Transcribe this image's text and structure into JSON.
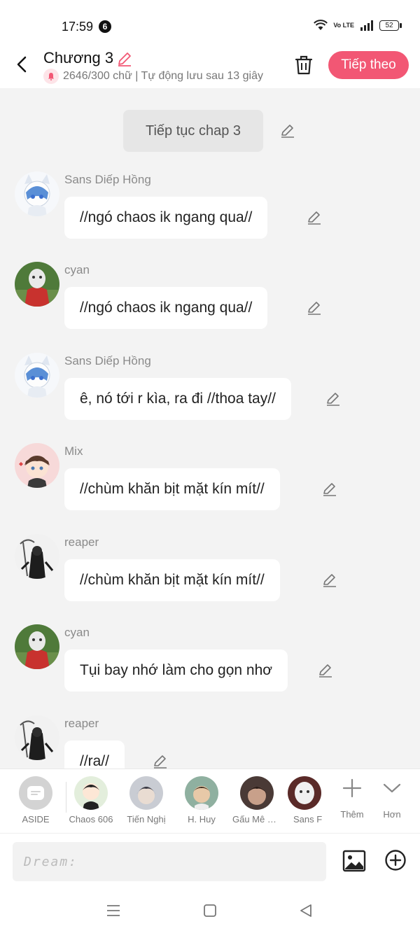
{
  "status_bar": {
    "time": "17:59",
    "notification_count": "6",
    "network_label": "Vo LTE",
    "battery": "52"
  },
  "header": {
    "title": "Chương 3",
    "word_count": "2646/300 chữ | Tự động lưu sau 13 giây",
    "next_label": "Tiếp theo"
  },
  "narration": "Tiếp tục chap 3",
  "messages": [
    {
      "name": "Sans Diếp Hồng",
      "text": "//ngó chaos ik ngang qua//",
      "avatar": "sans-avatar"
    },
    {
      "name": "cyan",
      "text": "//ngó chaos ik ngang qua//",
      "avatar": "cyan-avatar"
    },
    {
      "name": "Sans Diếp Hồng",
      "text": "ê, nó tới r kìa, ra đi //thoa tay//",
      "avatar": "sans-avatar"
    },
    {
      "name": "Mix",
      "text": "//chùm khăn bịt mặt kín mít//",
      "avatar": "mix-avatar"
    },
    {
      "name": "reaper",
      "text": "//chùm khăn bịt mặt kín mít//",
      "avatar": "reaper-avatar"
    },
    {
      "name": "cyan",
      "text": "Tụi bay nhớ làm cho gọn nhơ",
      "avatar": "cyan-avatar"
    },
    {
      "name": "reaper",
      "text": "//ra//",
      "avatar": "reaper-avatar"
    }
  ],
  "characters": [
    {
      "label": "ASIDE"
    },
    {
      "label": "Chaos 606"
    },
    {
      "label": "Tiến Nghị"
    },
    {
      "label": "H. Huy"
    },
    {
      "label": "Gấu Mê M..."
    },
    {
      "label": "Sans F"
    }
  ],
  "tools": {
    "add_label": "Thêm",
    "more_label": "Hơn"
  },
  "input": {
    "placeholder": "Dream:"
  },
  "colors": {
    "accent": "#f25774",
    "background": "#f3f3f3"
  }
}
